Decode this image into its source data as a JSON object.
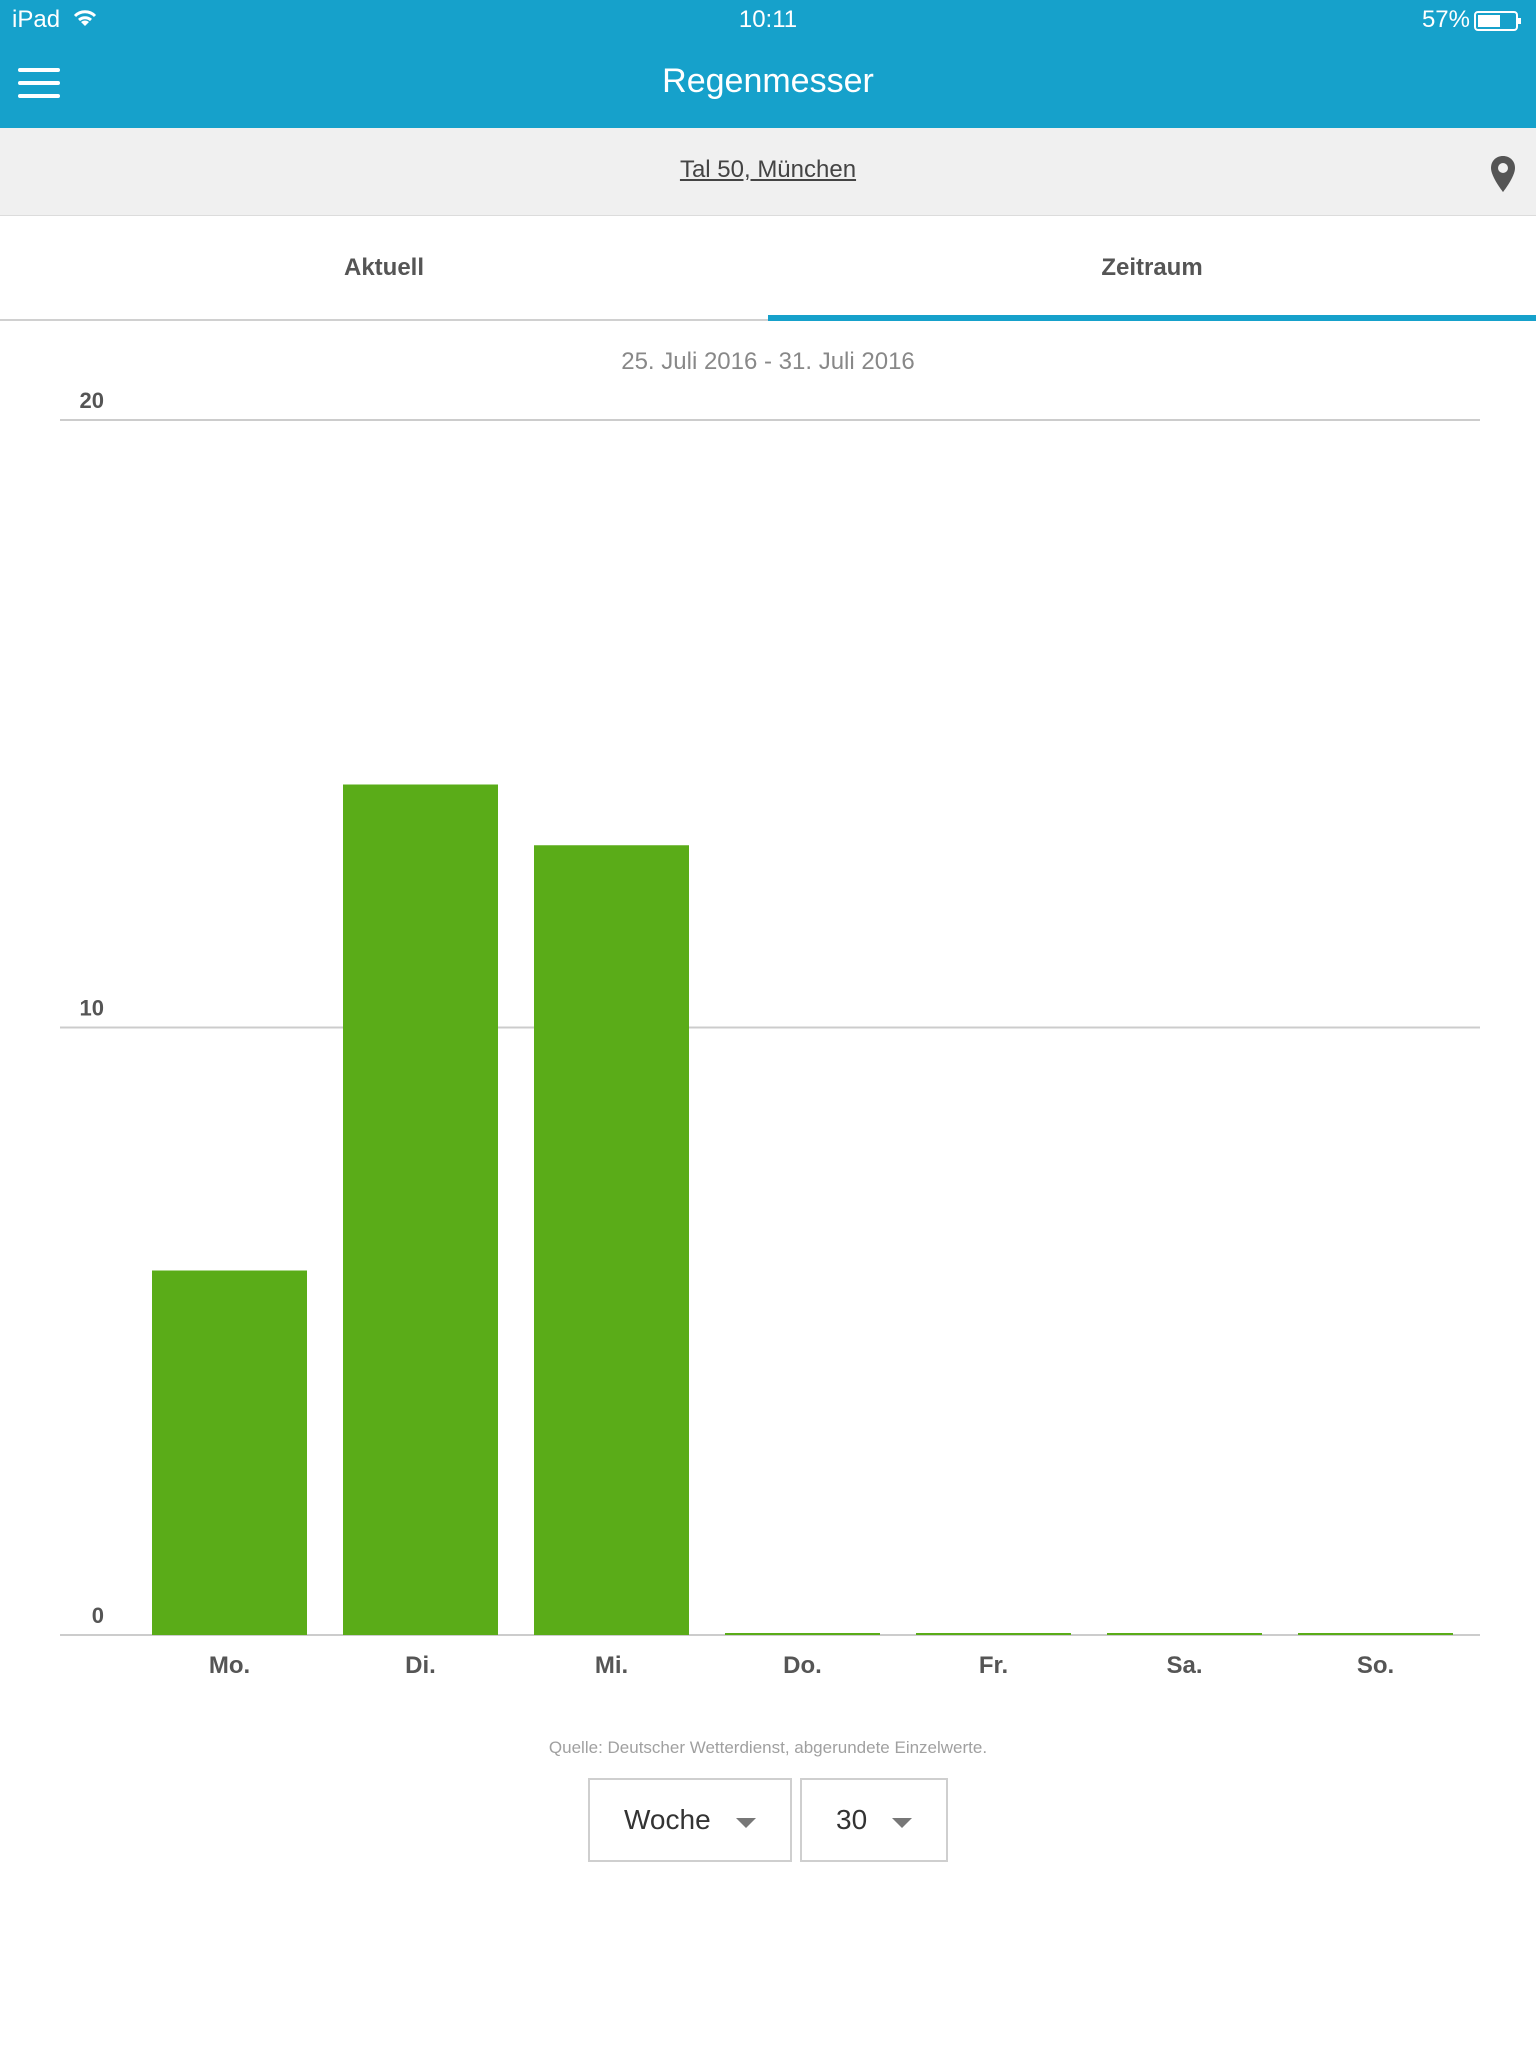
{
  "status_bar": {
    "device": "iPad",
    "time": "10:11",
    "battery": "57%"
  },
  "header": {
    "title": "Regenmesser"
  },
  "location": {
    "label": "Tal 50, München"
  },
  "tabs": [
    {
      "label": "Aktuell"
    },
    {
      "label": "Zeitraum"
    }
  ],
  "active_tab": 1,
  "date_range": "25. Juli 2016 - 31. Juli 2016",
  "colors": {
    "accent": "#16a1cb",
    "bar": "#5aac18",
    "grid": "#cccccc"
  },
  "chart_data": {
    "type": "bar",
    "categories": [
      "Mo.",
      "Di.",
      "Mi.",
      "Do.",
      "Fr.",
      "Sa.",
      "So."
    ],
    "values": [
      6,
      14,
      13,
      0,
      0,
      0,
      0
    ],
    "yticks": [
      0,
      10,
      20
    ],
    "ylim": [
      0,
      20
    ],
    "grid": true
  },
  "source_note": "Quelle: Deutscher Wetterdienst, abgerundete Einzelwerte.",
  "controls": {
    "period": {
      "value": "Woche"
    },
    "week": {
      "value": "30"
    }
  }
}
